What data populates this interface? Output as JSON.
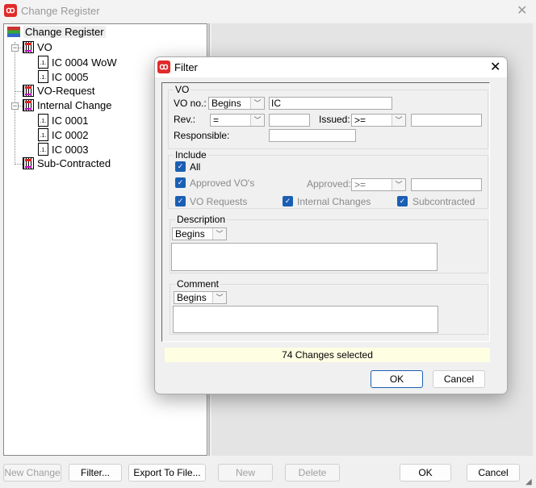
{
  "window": {
    "title": "Change Register",
    "close_icon": "close-icon"
  },
  "tree": {
    "root": "Change Register",
    "nodes": [
      {
        "label": "VO",
        "children": [
          "IC 0004 WoW",
          "IC 0005"
        ]
      },
      {
        "label": "VO-Request",
        "children": []
      },
      {
        "label": "Internal Change",
        "children": [
          "IC 0001",
          "IC 0002",
          "IC 0003"
        ]
      },
      {
        "label": "Sub-Contracted",
        "children": []
      }
    ]
  },
  "toolbar": {
    "new_change": "New Change",
    "filter": "Filter...",
    "export": "Export To File...",
    "new": "New",
    "delete": "Delete",
    "ok": "OK",
    "cancel": "Cancel"
  },
  "filter": {
    "title": "Filter",
    "vo": {
      "legend": "VO",
      "vo_no_label": "VO no.:",
      "vo_no_op": "Begins",
      "vo_no_value": "IC",
      "rev_label": "Rev.:",
      "rev_op": "=",
      "rev_value": "",
      "issued_label": "Issued:",
      "issued_op": ">=",
      "issued_value": "",
      "responsible_label": "Responsible:",
      "responsible_value": ""
    },
    "include": {
      "legend": "Include",
      "all": "All",
      "all_checked": true,
      "approved_vos": "Approved VO's",
      "approved_vos_checked": true,
      "approved_label": "Approved:",
      "approved_op": ">=",
      "approved_value": "",
      "vo_requests": "VO Requests",
      "vo_requests_checked": true,
      "internal_changes": "Internal Changes",
      "internal_changes_checked": true,
      "subcontracted": "Subcontracted",
      "subcontracted_checked": true
    },
    "description": {
      "legend": "Description",
      "op": "Begins",
      "value": ""
    },
    "comment": {
      "legend": "Comment",
      "op": "Begins",
      "value": ""
    },
    "status": "74 Changes selected",
    "ok": "OK",
    "cancel": "Cancel"
  },
  "colors": {
    "accent": "#1a5fb4",
    "status_bg": "#fefee3",
    "app_icon": "#e02a2a"
  }
}
